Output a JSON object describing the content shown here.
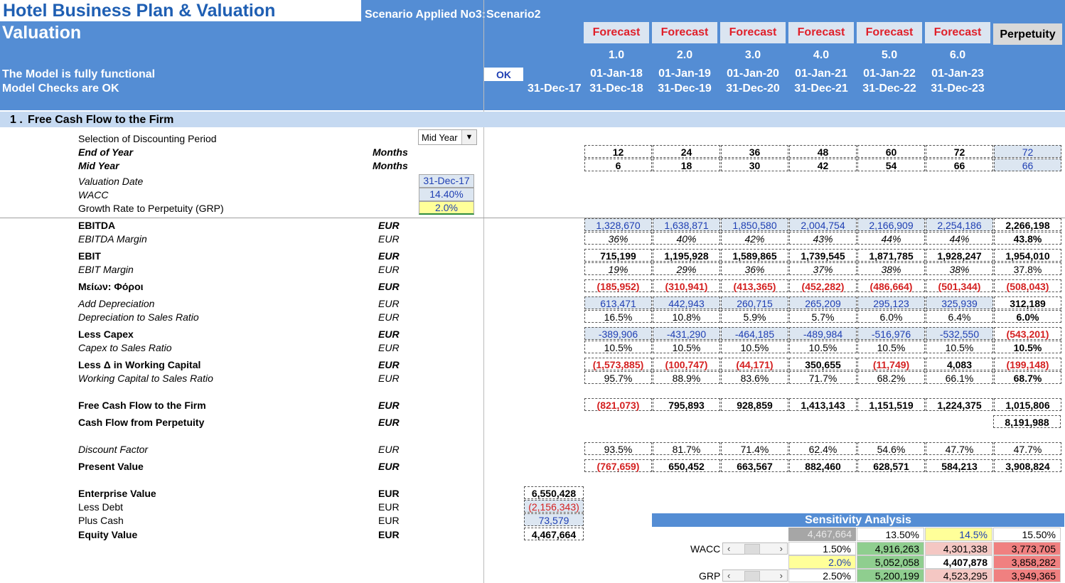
{
  "header": {
    "title": "Hotel Business Plan & Valuation",
    "subtitle": "Valuation",
    "scenario_label": "Scenario Applied No3:",
    "scenario_value": "Scenario2",
    "status1": "The Model is fully functional",
    "status2": "Model Checks are OK",
    "ok_badge": "OK",
    "valuation_col_date": "31-Dec-17",
    "perpetuity_label": "Perpetuity",
    "periods": [
      {
        "label": "Forecast",
        "num": "1.0",
        "start": "01-Jan-18",
        "end": "31-Dec-18"
      },
      {
        "label": "Forecast",
        "num": "2.0",
        "start": "01-Jan-19",
        "end": "31-Dec-19"
      },
      {
        "label": "Forecast",
        "num": "3.0",
        "start": "01-Jan-20",
        "end": "31-Dec-20"
      },
      {
        "label": "Forecast",
        "num": "4.0",
        "start": "01-Jan-21",
        "end": "31-Dec-21"
      },
      {
        "label": "Forecast",
        "num": "5.0",
        "start": "01-Jan-22",
        "end": "31-Dec-22"
      },
      {
        "label": "Forecast",
        "num": "6.0",
        "start": "01-Jan-23",
        "end": "31-Dec-23"
      }
    ]
  },
  "section": {
    "number": "1 .",
    "title": "Free Cash Flow to the Firm"
  },
  "settings": {
    "discount_label": "Selection of Discounting Period",
    "discount_value": "Mid Year",
    "eoy_label": "End of Year",
    "mid_label": "Mid Year",
    "months": "Months",
    "valdate_label": "Valuation Date",
    "valdate_value": "31-Dec-17",
    "wacc_label": "WACC",
    "wacc_value": "14.40%",
    "grp_label": "Growth Rate to Perpetuity (GRP)",
    "grp_value": "2.0%",
    "eoy_months": [
      "12",
      "24",
      "36",
      "48",
      "60",
      "72",
      "72"
    ],
    "mid_months": [
      "6",
      "18",
      "30",
      "42",
      "54",
      "66",
      "66"
    ]
  },
  "rows": {
    "ebitda": {
      "label": "EBITDA",
      "unit": "EUR",
      "values": [
        "1,328,670",
        "1,638,871",
        "1,850,580",
        "2,004,754",
        "2,166,909",
        "2,254,186",
        "2,266,198"
      ]
    },
    "ebitda_margin": {
      "label": "EBITDA Margin",
      "unit": "EUR",
      "values": [
        "36%",
        "40%",
        "42%",
        "43%",
        "44%",
        "44%",
        "43.8%"
      ]
    },
    "ebit": {
      "label": "EBIT",
      "unit": "EUR",
      "values": [
        "715,199",
        "1,195,928",
        "1,589,865",
        "1,739,545",
        "1,871,785",
        "1,928,247",
        "1,954,010"
      ]
    },
    "ebit_margin": {
      "label": "EBIT Margin",
      "unit": "EUR",
      "values": [
        "19%",
        "29%",
        "36%",
        "37%",
        "38%",
        "38%",
        "37.8%"
      ]
    },
    "taxes": {
      "label": "Μείων: Φόροι",
      "unit": "EUR",
      "values": [
        "(185,952)",
        "(310,941)",
        "(413,365)",
        "(452,282)",
        "(486,664)",
        "(501,344)",
        "(508,043)"
      ]
    },
    "depr": {
      "label": "Add Depreciation",
      "unit": "EUR",
      "values": [
        "613,471",
        "442,943",
        "260,715",
        "265,209",
        "295,123",
        "325,939",
        "312,189"
      ]
    },
    "depr_ratio": {
      "label": "Depreciation to Sales Ratio",
      "unit": "EUR",
      "values": [
        "16.5%",
        "10.8%",
        "5.9%",
        "5.7%",
        "6.0%",
        "6.4%",
        "6.0%"
      ]
    },
    "capex": {
      "label": "Less Capex",
      "unit": "EUR",
      "values": [
        "-389,906",
        "-431,290",
        "-464,185",
        "-489,984",
        "-516,976",
        "-532,550",
        "(543,201)"
      ]
    },
    "capex_ratio": {
      "label": "Capex to Sales Ratio",
      "unit": "EUR",
      "values": [
        "10.5%",
        "10.5%",
        "10.5%",
        "10.5%",
        "10.5%",
        "10.5%",
        "10.5%"
      ]
    },
    "wc": {
      "label": "Less Δ in Working Capital",
      "unit": "EUR",
      "values": [
        "(1,573,885)",
        "(100,747)",
        "(44,171)",
        "350,655",
        "(11,749)",
        "4,083",
        "(199,148)"
      ]
    },
    "wc_ratio": {
      "label": "Working Capital to Sales Ratio",
      "unit": "EUR",
      "values": [
        "95.7%",
        "88.9%",
        "83.6%",
        "71.7%",
        "68.2%",
        "66.1%",
        "68.7%"
      ]
    },
    "fcff": {
      "label": "Free Cash Flow to the Firm",
      "unit": "EUR",
      "values": [
        "(821,073)",
        "795,893",
        "928,859",
        "1,413,143",
        "1,151,519",
        "1,224,375",
        "1,015,806"
      ]
    },
    "cfp": {
      "label": "Cash Flow from Perpetuity",
      "unit": "EUR",
      "value": "8,191,988"
    },
    "df": {
      "label": "Discount Factor",
      "unit": "EUR",
      "values": [
        "93.5%",
        "81.7%",
        "71.4%",
        "62.4%",
        "54.6%",
        "47.7%",
        "47.7%"
      ]
    },
    "pv": {
      "label": "Present Value",
      "unit": "EUR",
      "values": [
        "(767,659)",
        "650,452",
        "663,567",
        "882,460",
        "628,571",
        "584,213",
        "3,908,824"
      ]
    }
  },
  "valuation": {
    "ev_label": "Enterprise Value",
    "ev": "6,550,428",
    "debt_label": "Less Debt",
    "debt": "(2,156,343)",
    "cash_label": "Plus Cash",
    "cash": "73,579",
    "eq_label": "Equity Value",
    "eq": "4,467,664",
    "unit": "EUR"
  },
  "sensitivity": {
    "title": "Sensitivity Analysis",
    "corner": "4,467,664",
    "wacc_label": "WACC",
    "grp_label": "GRP",
    "wacc_cols": [
      "13.50%",
      "14.5%",
      "15.50%"
    ],
    "grp_rows": [
      "1.50%",
      "2.0%",
      "2.50%"
    ],
    "matrix": [
      [
        "4,916,263",
        "4,301,338",
        "3,773,705"
      ],
      [
        "5,052,058",
        "4,407,878",
        "3,858,282"
      ],
      [
        "5,200,199",
        "4,523,295",
        "3,949,365"
      ]
    ],
    "colors": {
      "green": "#8fce8f",
      "pink": "#f4c7c3",
      "red": "#f08080"
    }
  }
}
